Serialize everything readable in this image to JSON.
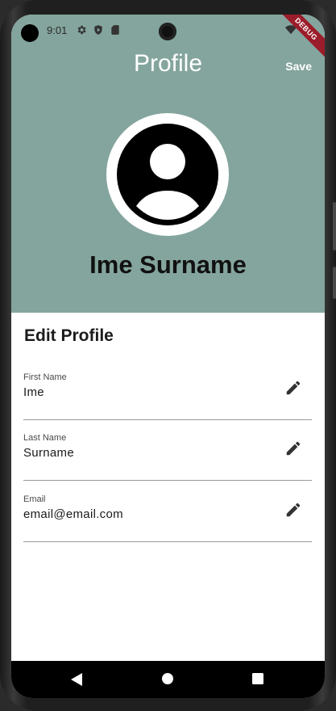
{
  "status_bar": {
    "time": "9:01",
    "icons": [
      "settings-icon",
      "shield-icon",
      "sd-card-icon",
      "wifi-icon",
      "battery-icon"
    ],
    "debug_banner": "DEBUG"
  },
  "app_bar": {
    "title": "Profile",
    "save_label": "Save"
  },
  "profile": {
    "avatar_icon": "account-circle-icon",
    "full_name": "Ime Surname"
  },
  "form": {
    "section_title": "Edit Profile",
    "fields": [
      {
        "label": "First Name",
        "value": "Ime",
        "icon": "edit-pencil-icon"
      },
      {
        "label": "Last Name",
        "value": "Surname",
        "icon": "edit-pencil-icon"
      },
      {
        "label": "Email",
        "value": "email@email.com",
        "icon": "edit-pencil-icon"
      }
    ]
  },
  "nav_bar": {
    "buttons": [
      "back-icon",
      "home-icon",
      "recents-icon"
    ]
  },
  "colors": {
    "header_bg": "#84a59d",
    "debug_ribbon": "#9b1c2a",
    "screen_bg": "#ffffff"
  }
}
